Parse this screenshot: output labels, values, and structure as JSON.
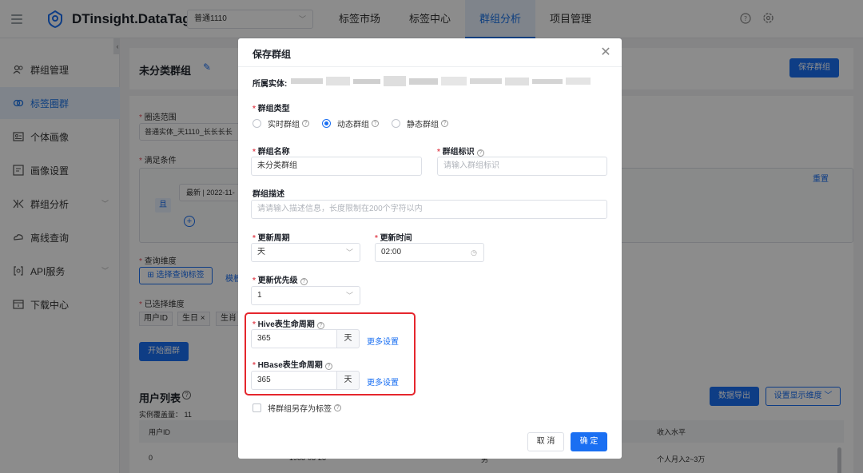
{
  "header": {
    "app_title": "DTinsight.DataTag",
    "project_select": "普通1110",
    "nav": [
      "标签市场",
      "标签中心",
      "群组分析",
      "项目管理"
    ],
    "active_nav": "群组分析"
  },
  "sidebar": {
    "items": [
      {
        "label": "群组管理",
        "icon": "users-icon"
      },
      {
        "label": "标签圈群",
        "icon": "circles-icon"
      },
      {
        "label": "个体画像",
        "icon": "profile-card-icon"
      },
      {
        "label": "画像设置",
        "icon": "portrait-settings-icon"
      },
      {
        "label": "群组分析",
        "icon": "analysis-icon"
      },
      {
        "label": "离线查询",
        "icon": "offline-query-icon"
      },
      {
        "label": "API服务",
        "icon": "api-icon"
      },
      {
        "label": "下载中心",
        "icon": "download-icon"
      }
    ],
    "active": "标签圈群"
  },
  "background": {
    "group_title": "未分类群组",
    "save_group_button": "保存群组",
    "scope_label": "圈选范围",
    "scope_value": "普通实体_天1110_长长长长",
    "condition_label": "满足条件",
    "condition_item": "最新 | 2022-11-",
    "and_label": "且",
    "reset_link": "重置",
    "query_dim_label": "查询维度",
    "select_query_tag_button": "选择查询标签",
    "template_link": "模板",
    "selected_dim_label": "已选择维度",
    "selected_tags": [
      "用户ID",
      "生日 ×",
      "生肖"
    ],
    "start_button": "开始圈群",
    "user_list_title": "用户列表",
    "coverage_text": "实例覆盖量： 11",
    "export_button": "数据导出",
    "display_dim_button": "设置显示维度",
    "table_headers": [
      "用户ID",
      "收入水平"
    ],
    "table_row": {
      "user_id": "0",
      "birthday": "1988-03-28",
      "gender": "男",
      "income": "个人月入2~3万"
    }
  },
  "modal": {
    "title": "保存群组",
    "entity_label": "所属实体:",
    "group_type_label": "群组类型",
    "group_types": [
      "实时群组",
      "动态群组",
      "静态群组"
    ],
    "selected_group_type": "动态群组",
    "group_name_label": "群组名称",
    "group_name_value": "未分类群组",
    "group_id_label": "群组标识",
    "group_id_placeholder": "请输入群组标识",
    "desc_label": "群组描述",
    "desc_placeholder": "请请输入描述信息，长度限制在200个字符以内",
    "update_cycle_label": "更新周期",
    "update_cycle_value": "天",
    "update_time_label": "更新时间",
    "update_time_value": "02:00",
    "priority_label": "更新优先级",
    "priority_value": "1",
    "hive_label": "Hive表生命周期",
    "hive_value": "365",
    "hive_unit": "天",
    "hive_more": "更多设置",
    "hbase_label": "HBase表生命周期",
    "hbase_value": "365",
    "hbase_unit": "天",
    "hbase_more": "更多设置",
    "save_as_tag_label": "将群组另存为标签",
    "cancel_button": "取 消",
    "confirm_button": "确 定"
  },
  "colors": {
    "primary": "#1a6ff2",
    "highlight": "#e5262d"
  }
}
